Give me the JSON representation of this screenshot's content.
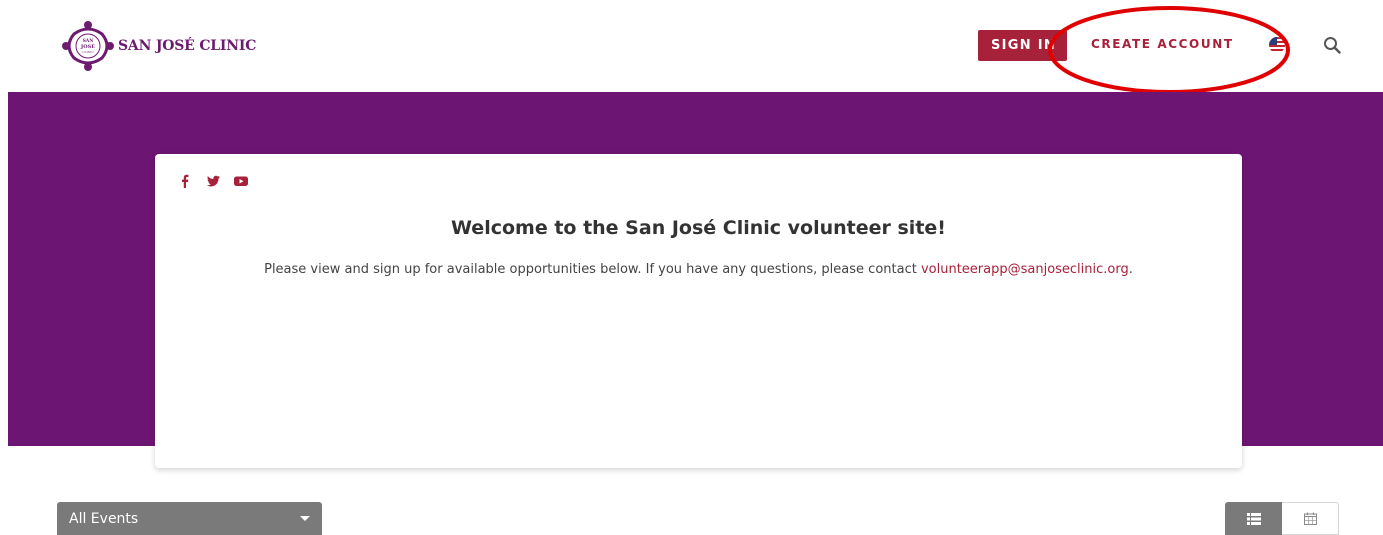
{
  "header": {
    "logo_text": "SAN JOSÉ CLINIC",
    "logo_badge_lines": [
      "SAN",
      "JOSÉ",
      "CLINIC"
    ],
    "sign_in_label": "SIGN IN",
    "create_account_label": "CREATE ACCOUNT",
    "icons": {
      "language": "us-flag-icon",
      "search": "search-icon"
    }
  },
  "card": {
    "socials": [
      "facebook-icon",
      "twitter-icon",
      "youtube-icon"
    ],
    "title": "Welcome to the San José Clinic volunteer site!",
    "intro_text": "Please view and sign up for available opportunities below.  If you have any questions, please contact ",
    "contact_email": "volunteerapp@sanjoseclinic.org",
    "intro_suffix": "."
  },
  "filters": {
    "events_select_value": "All Events",
    "view_modes": [
      "list-view-icon",
      "calendar-view-icon"
    ]
  },
  "colors": {
    "brand_purple": "#6d1573",
    "accent_red": "#a8213a",
    "annotation_red": "#e00000",
    "control_gray": "#7a7a7a"
  }
}
